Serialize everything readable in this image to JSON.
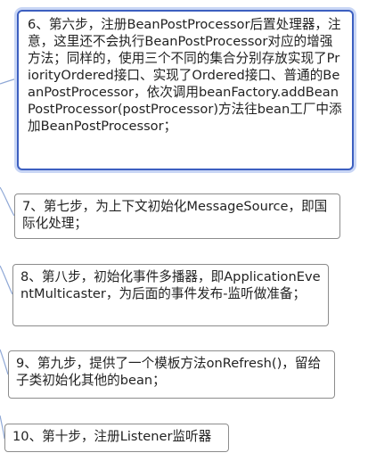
{
  "colors": {
    "connector": "#8fa8d6",
    "node_border": "#8c8c8c",
    "selected_border": "#3c5fc0",
    "selected_glow": "#c9d6f5",
    "text": "#222222"
  },
  "nodes": [
    {
      "id": "step-6",
      "selected": true,
      "text": "6、第六步，注册BeanPostProcessor后置处理器，注意，这里还不会执行BeanPostProcessor对应的增强方法；同样的，使用三个不同的集合分别存放实现了PriorityOrdered接口、实现了Ordered接口、普通的BeanPostProcessor，依次调用beanFactory.addBeanPostProcessor(postProcessor)方法往bean工厂中添加BeanPostProcessor；"
    },
    {
      "id": "step-7",
      "selected": false,
      "text": "7、第七步，为上下文初始化MessageSource，即国际化处理；"
    },
    {
      "id": "step-8",
      "selected": false,
      "text": "8、第八步，初始化事件多播器，即ApplicationEventMulticaster，为后面的事件发布-监听做准备；"
    },
    {
      "id": "step-9",
      "selected": false,
      "text": "9、第九步，提供了一个模板方法onRefresh()，留给子类初始化其他的bean；"
    },
    {
      "id": "step-10",
      "selected": false,
      "text": "10、第十步，注册Listener监听器"
    }
  ]
}
